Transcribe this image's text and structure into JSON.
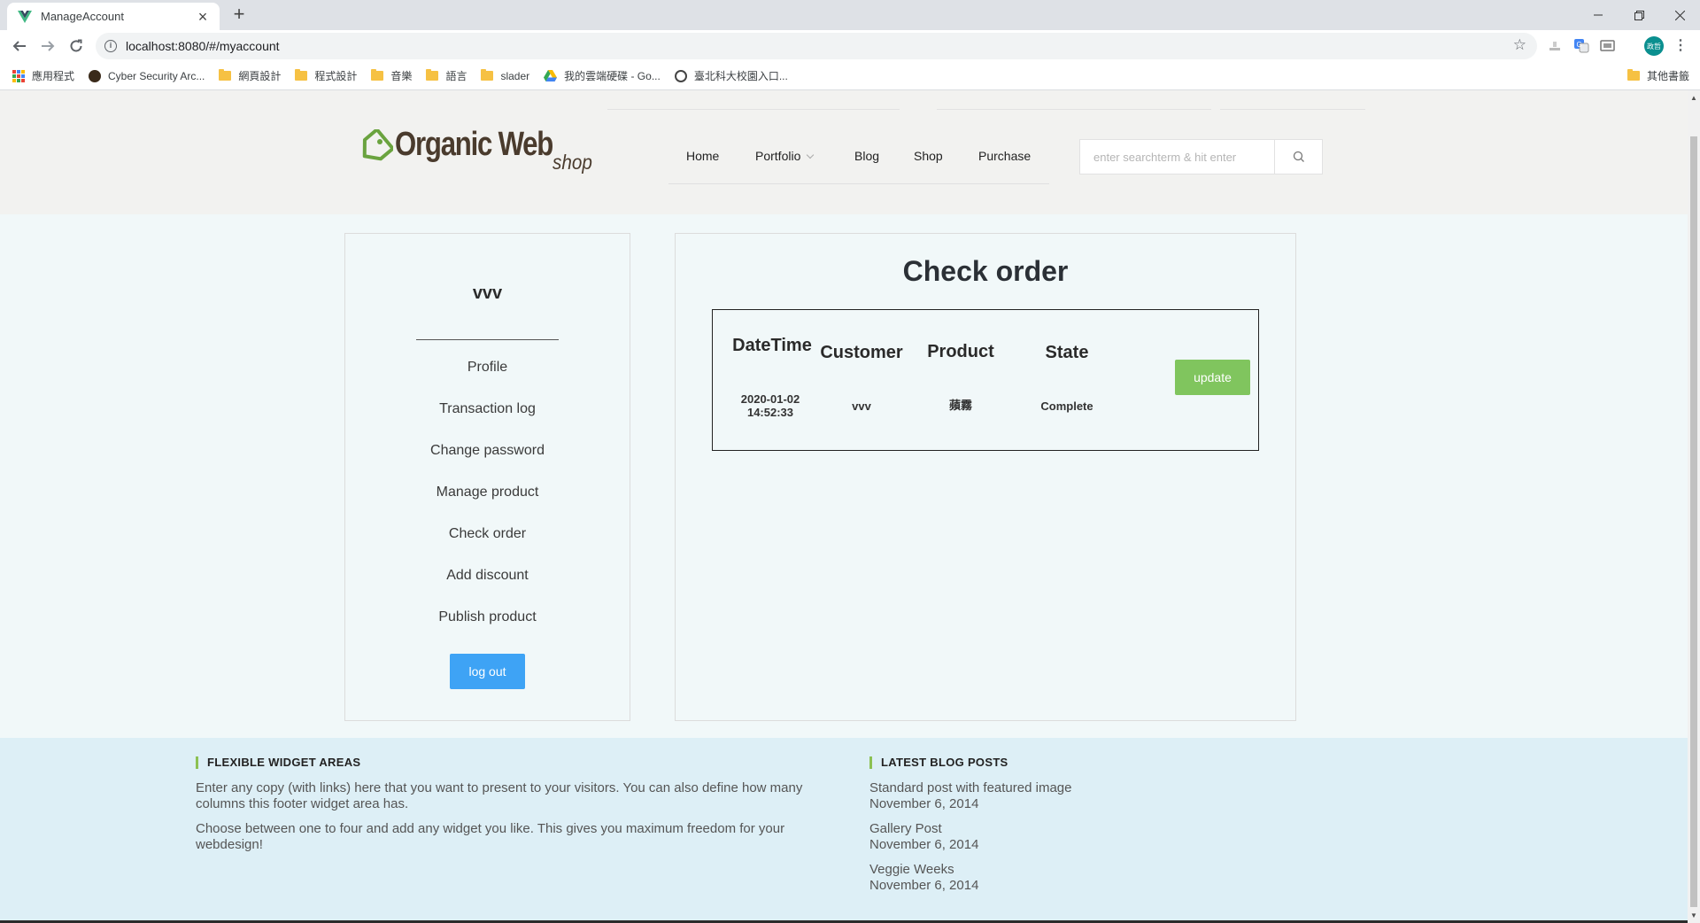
{
  "browser": {
    "tab_title": "ManageAccount",
    "url": "localhost:8080/#/myaccount",
    "avatar_text": "政哲",
    "bookmarks": [
      {
        "label": "應用程式",
        "icon": "apps-icon"
      },
      {
        "label": "Cyber Security Arc...",
        "icon": "site-icon"
      },
      {
        "label": "網頁設計",
        "icon": "folder-icon"
      },
      {
        "label": "程式設計",
        "icon": "folder-icon"
      },
      {
        "label": "音樂",
        "icon": "folder-icon"
      },
      {
        "label": "語言",
        "icon": "folder-icon"
      },
      {
        "label": "slader",
        "icon": "folder-icon"
      },
      {
        "label": "我的雲端硬碟 - Go...",
        "icon": "drive-icon"
      },
      {
        "label": "臺北科大校園入口...",
        "icon": "site-icon"
      }
    ],
    "other_bookmarks": "其他書籤"
  },
  "header": {
    "logo_main": "Organic Web",
    "logo_sub": "shop",
    "nav": [
      "Home",
      "Portfolio",
      "Blog",
      "Shop",
      "Purchase"
    ],
    "search_placeholder": "enter searchterm & hit enter"
  },
  "sidebar": {
    "username": "vvv",
    "menu": [
      "Profile",
      "Transaction log",
      "Change password",
      "Manage product",
      "Check order",
      "Add discount",
      "Publish product"
    ],
    "logout_label": "log out"
  },
  "panel": {
    "title": "Check order",
    "columns": [
      "DateTime",
      "Customer",
      "Product",
      "State"
    ],
    "rows": [
      {
        "date": "2020-01-02",
        "time": "14:52:33",
        "customer": "vvv",
        "product": "蘋霧",
        "state": "Complete"
      }
    ],
    "update_label": "update"
  },
  "footer": {
    "widget1": {
      "title": "FLEXIBLE WIDGET AREAS",
      "p1": "Enter any copy (with links) here that you want to present to your visitors. You can also define how many columns this footer widget area has.",
      "p2": "Choose between one to four and add any widget you like. This gives you maximum freedom for your webdesign!"
    },
    "widget2": {
      "title": "LATEST BLOG POSTS",
      "posts": [
        {
          "title": "Standard post with featured image",
          "date": "November 6, 2014"
        },
        {
          "title": "Gallery Post",
          "date": "November 6, 2014"
        },
        {
          "title": "Veggie Weeks",
          "date": "November 6, 2014"
        }
      ]
    }
  },
  "colors": {
    "accent_green": "#80c55e",
    "logout_blue": "#3ea3f5",
    "footer_bg": "#ddeff6"
  }
}
